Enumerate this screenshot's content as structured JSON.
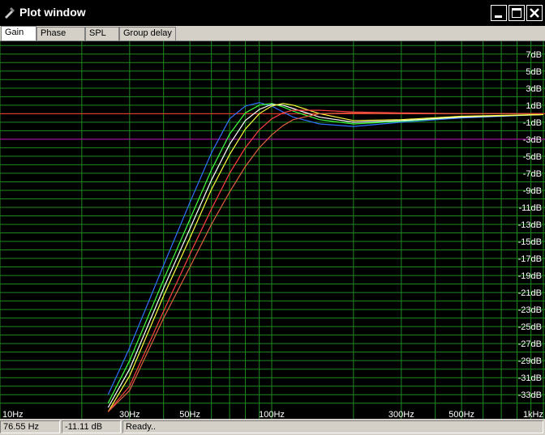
{
  "window": {
    "title": "Plot window"
  },
  "tabs": [
    {
      "label": "Gain",
      "active": true
    },
    {
      "label": "Phase plot",
      "active": false
    },
    {
      "label": "SPL",
      "active": false
    },
    {
      "label": "Group delay",
      "active": false
    }
  ],
  "status": {
    "frequency": "76.55 Hz",
    "gain": "-11.11 dB",
    "message": "Ready.."
  },
  "colors": {
    "grid": "#1f8a1f",
    "background": "#000000",
    "ref_red": "#ff3030",
    "ref_magenta": "#c000c0"
  },
  "chart_data": {
    "type": "line",
    "title": "",
    "xlabel": "",
    "ylabel": "",
    "x_scale": "log",
    "xlim": [
      10,
      1000
    ],
    "ylim": [
      -34.5,
      8.5
    ],
    "grid": true,
    "x_ticks": [
      {
        "value": 10,
        "label": "10Hz"
      },
      {
        "value": 30,
        "label": "30Hz"
      },
      {
        "value": 50,
        "label": "50Hz"
      },
      {
        "value": 100,
        "label": "100Hz"
      },
      {
        "value": 300,
        "label": "300Hz"
      },
      {
        "value": 500,
        "label": "500Hz"
      },
      {
        "value": 1000,
        "label": "1kHz"
      }
    ],
    "y_ticks": [
      {
        "value": 7,
        "label": "7dB"
      },
      {
        "value": 5,
        "label": "5dB"
      },
      {
        "value": 3,
        "label": "3dB"
      },
      {
        "value": 1,
        "label": "1dB"
      },
      {
        "value": -1,
        "label": "-1dB"
      },
      {
        "value": -3,
        "label": "-3dB"
      },
      {
        "value": -5,
        "label": "-5dB"
      },
      {
        "value": -7,
        "label": "-7dB"
      },
      {
        "value": -9,
        "label": "-9dB"
      },
      {
        "value": -11,
        "label": "-11dB"
      },
      {
        "value": -13,
        "label": "-13dB"
      },
      {
        "value": -15,
        "label": "-15dB"
      },
      {
        "value": -17,
        "label": "-17dB"
      },
      {
        "value": -19,
        "label": "-19dB"
      },
      {
        "value": -21,
        "label": "-21dB"
      },
      {
        "value": -23,
        "label": "-23dB"
      },
      {
        "value": -25,
        "label": "-25dB"
      },
      {
        "value": -27,
        "label": "-27dB"
      },
      {
        "value": -29,
        "label": "-29dB"
      },
      {
        "value": -31,
        "label": "-31dB"
      },
      {
        "value": -33,
        "label": "-33dB"
      }
    ],
    "reference_lines": [
      {
        "y": 0,
        "color": "#ff3030"
      },
      {
        "y": -3,
        "color": "#c000c0"
      }
    ],
    "x": [
      25,
      30,
      40,
      50,
      60,
      70,
      80,
      90,
      100,
      110,
      120,
      150,
      200,
      300,
      500,
      1000
    ],
    "series": [
      {
        "color": "#3070ff",
        "values": [
          -33,
          -27.5,
          -17.8,
          -10.4,
          -4.6,
          -0.6,
          0.9,
          1.3,
          0.9,
          0.2,
          -0.4,
          -1.2,
          -1.5,
          -1.0,
          -0.5,
          -0.1
        ]
      },
      {
        "color": "#40ff40",
        "values": [
          -34,
          -29,
          -19.5,
          -12.4,
          -6.6,
          -2.4,
          0.1,
          1.0,
          1.2,
          0.8,
          0.3,
          -0.7,
          -1.2,
          -0.9,
          -0.4,
          -0.1
        ]
      },
      {
        "color": "#ffffff",
        "values": [
          -34.5,
          -30,
          -20.5,
          -13.5,
          -7.8,
          -3.6,
          -0.8,
          0.5,
          1.1,
          1.0,
          0.6,
          -0.4,
          -1.0,
          -0.8,
          -0.4,
          -0.1
        ]
      },
      {
        "color": "#ffff40",
        "values": [
          -35,
          -30.8,
          -21.4,
          -14.6,
          -8.9,
          -4.8,
          -1.8,
          0.0,
          0.9,
          1.2,
          1.0,
          0.0,
          -0.8,
          -0.7,
          -0.3,
          -0.1
        ]
      },
      {
        "color": "#ff4040",
        "values": [
          -35,
          -32,
          -23.2,
          -16.5,
          -11.2,
          -7.0,
          -4.0,
          -1.9,
          -0.6,
          0.1,
          0.4,
          0.4,
          0.2,
          0.1,
          0.0,
          0.0
        ]
      },
      {
        "color": "#e06040",
        "values": [
          -35,
          -32.5,
          -24.0,
          -18.0,
          -13.0,
          -9.2,
          -6.2,
          -4.0,
          -2.5,
          -1.4,
          -0.7,
          0.0,
          0.1,
          0.0,
          0.0,
          0.0
        ]
      }
    ]
  }
}
